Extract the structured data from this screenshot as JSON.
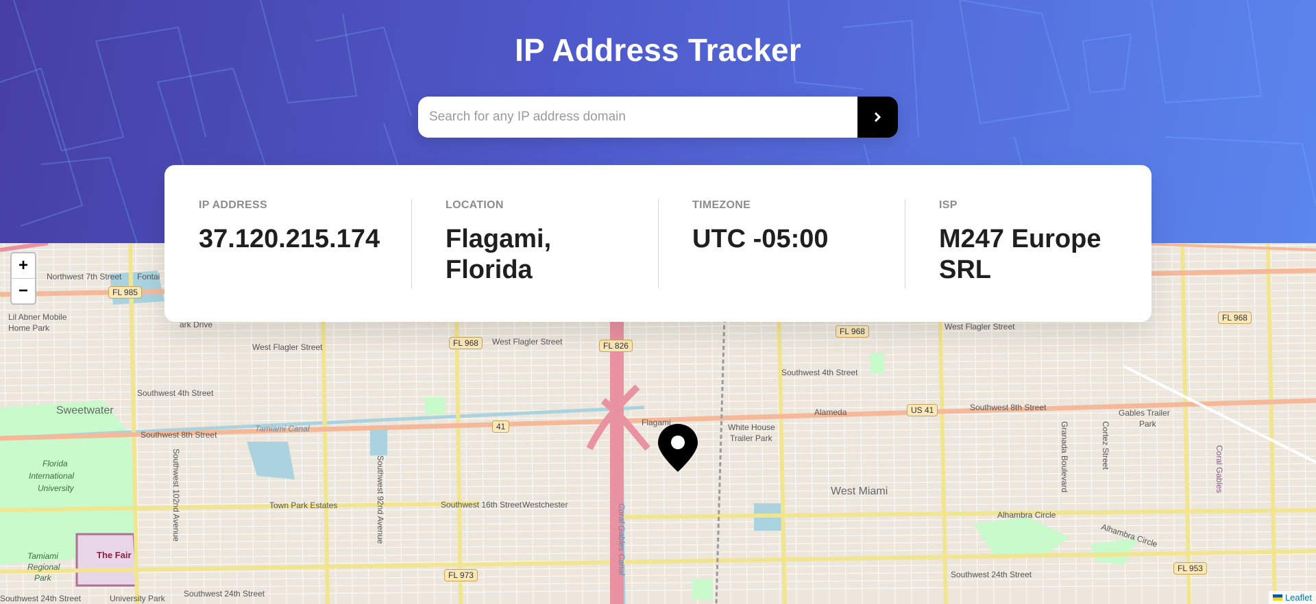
{
  "header": {
    "title": "IP Address Tracker",
    "search_placeholder": "Search for any IP address domain",
    "search_value": "",
    "submit_icon": "chevron-right-icon"
  },
  "info": [
    {
      "label": "IP Address",
      "value": "37.120.215.174"
    },
    {
      "label": "Location",
      "value": "Flagami, Florida"
    },
    {
      "label": "Timezone",
      "value": "UTC -05:00"
    },
    {
      "label": "ISP",
      "value": "M247 Europe SRL"
    }
  ],
  "map": {
    "zoom_in": "+",
    "zoom_out": "−",
    "attribution": "Leaflet",
    "marker_icon": "location-pin-icon",
    "labels": {
      "sweetwater": "Sweetwater",
      "nw7": "Northwest 7th Street",
      "fontai": "Fontai",
      "lil_abner": "Lil Abner Mobile",
      "home_park": "Home Park",
      "park_drive": "ark Drive",
      "west_flagler_1": "West Flagler Street",
      "west_flagler_2": "West Flagler Street",
      "west_flagler_3": "West Flagler Street",
      "sw4_1": "Southwest 4th Street",
      "sw4_2": "Southwest 4th Street",
      "sw8_1": "Southwest 8th Street",
      "sw8_2": "Southwest 8th Street",
      "tamiami_canal": "Tamiami Canal",
      "flagami": "Flagami",
      "white_house_1": "White House",
      "white_house_2": "Trailer Park",
      "alameda": "Alameda",
      "gables_trailer_1": "Gables Trailer",
      "gables_trailer_2": "Park",
      "town_park": "Town Park Estates",
      "sw16": "Southwest 16th Street",
      "westchester": "Westchester",
      "west_miami": "West Miami",
      "alhambra_circle_1": "Alhambra Circle",
      "alhambra_circle_2": "Alhambra Circle",
      "sw24_1": "Southwest 24th Street",
      "sw24_2": "Southwest 24th Street",
      "sw24_3": "Southwest 24th Street",
      "university_park": "University Park",
      "fiu_1": "Florida",
      "fiu_2": "International",
      "fiu_3": "University",
      "tamiami_park_1": "Tamiami",
      "tamiami_park_2": "Regional",
      "tamiami_park_3": "Park",
      "the_fair": "The Fair",
      "sw102": "Southwest 102nd Avenue",
      "sw92": "Southwest 92nd Avenue",
      "granada": "Granada Boulevard",
      "cortez": "Cortez Street",
      "coral_gables": "Coral Gables",
      "coral_gables_canal": "Coral Gables Canal"
    },
    "shields": {
      "fl985": "FL 985",
      "fl968_a": "FL 968",
      "fl968_b": "FL 968",
      "fl968_c": "FL 968",
      "fl826": "FL 826",
      "us41_a": "41",
      "us41_b": "US 41",
      "fl973": "FL 973",
      "fl953": "FL 953"
    },
    "colors": {
      "motorway": "#e892a2",
      "primary": "#f9b29c",
      "secondary": "#f7fabf",
      "park": "#c8facc",
      "water": "#aad3df",
      "land": "#ece6dc"
    }
  }
}
